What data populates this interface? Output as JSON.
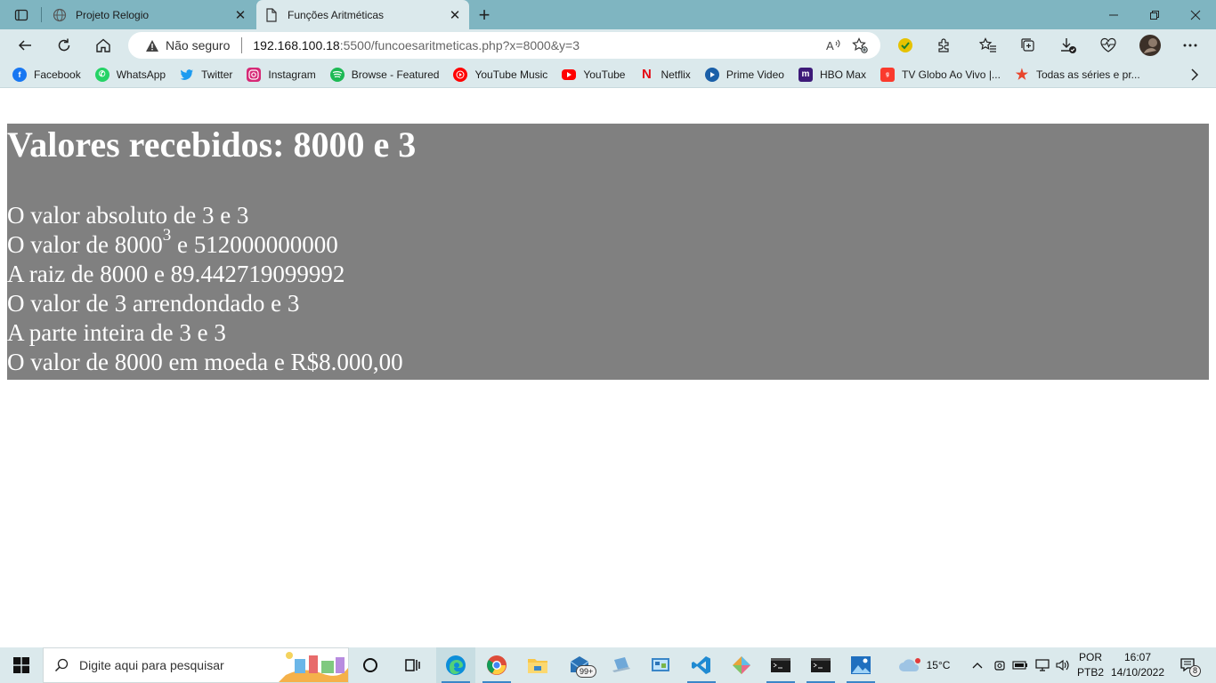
{
  "browser": {
    "tabs": [
      {
        "title": "Projeto Relogio",
        "active": false
      },
      {
        "title": "Funções Aritméticas",
        "active": true
      }
    ],
    "address": {
      "security": "Não seguro",
      "host": "192.168.100.18",
      "path": ":5500/funcoesaritmeticas.php?x=8000&y=3"
    },
    "favorites": [
      {
        "label": "Facebook",
        "icon": "facebook-icon",
        "color": "#1877f2"
      },
      {
        "label": "WhatsApp",
        "icon": "whatsapp-icon",
        "color": "#25d366"
      },
      {
        "label": "Twitter",
        "icon": "twitter-icon",
        "color": "#1d9bf0"
      },
      {
        "label": "Instagram",
        "icon": "instagram-icon",
        "color": "#d62976"
      },
      {
        "label": "Browse - Featured",
        "icon": "spotify-icon",
        "color": "#1db954"
      },
      {
        "label": "YouTube Music",
        "icon": "youtube-music-icon",
        "color": "#ff0000"
      },
      {
        "label": "YouTube",
        "icon": "youtube-icon",
        "color": "#ff0000"
      },
      {
        "label": "Netflix",
        "icon": "netflix-icon",
        "color": "#e50914"
      },
      {
        "label": "Prime Video",
        "icon": "prime-video-icon",
        "color": "#1a98ff"
      },
      {
        "label": "HBO Max",
        "icon": "hbo-max-icon",
        "color": "#5822b4"
      },
      {
        "label": "TV Globo Ao Vivo |...",
        "icon": "globoplay-icon",
        "color": "#fa3a2d"
      },
      {
        "label": "Todas as séries e pr...",
        "icon": "star-icon",
        "color": "#e8452c"
      }
    ]
  },
  "page": {
    "heading": "Valores recebidos: 8000 e 3",
    "abs_line": "O valor absoluto de 3 e 3",
    "pow_prefix": "O valor de 8000",
    "pow_exponent": "3",
    "pow_suffix": " e 512000000000",
    "sqrt_line": "A raiz de 8000 e 89.442719099992",
    "round_line": "O valor de 3 arrendondado e 3",
    "int_line": "A parte inteira de 3 e 3",
    "money_line": "O valor de 8000 em moeda e R$8.000,00"
  },
  "taskbar": {
    "search_placeholder": "Digite aqui para pesquisar",
    "mail_badge": "99+",
    "weather": "15°C",
    "lang_top": "POR",
    "lang_bottom": "PTB2",
    "time": "16:07",
    "date": "14/10/2022",
    "notifications": "8"
  },
  "colors": {
    "chrome": "#7fb5c1",
    "toolbar": "#dbe9ec",
    "result_bg": "#808080"
  }
}
